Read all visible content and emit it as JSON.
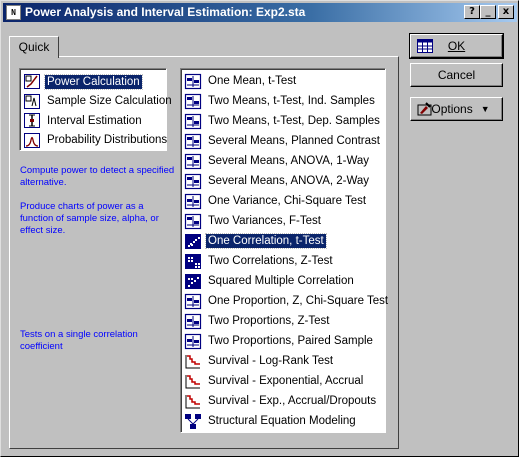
{
  "window": {
    "title": "Power Analysis and Interval Estimation: Exp2.sta",
    "controls": {
      "help": "?",
      "minimize": "_",
      "close": "x"
    }
  },
  "tabs": [
    {
      "label": "Quick"
    }
  ],
  "categories": [
    {
      "label": "Power Calculation",
      "icon": "power-calc-icon",
      "selected": true
    },
    {
      "label": "Sample Size Calculation",
      "icon": "sample-size-icon",
      "selected": false
    },
    {
      "label": "Interval Estimation",
      "icon": "interval-icon",
      "selected": false
    },
    {
      "label": "Probability Distributions",
      "icon": "distribution-icon",
      "selected": false
    }
  ],
  "descriptions": {
    "category_line1": "Compute power to detect a specified alternative.",
    "category_line2": "Produce charts of power as a function of sample size, alpha, or effect size.",
    "test_description": "Tests on a single correlation coefficient"
  },
  "tests": [
    {
      "label": "One Mean, t-Test",
      "icon": "one-mean-icon",
      "selected": false
    },
    {
      "label": "Two Means, t-Test, Ind. Samples",
      "icon": "two-means-ind-icon",
      "selected": false
    },
    {
      "label": "Two Means, t-Test, Dep. Samples",
      "icon": "two-means-dep-icon",
      "selected": false
    },
    {
      "label": "Several Means, Planned Contrast",
      "icon": "planned-contrast-icon",
      "selected": false
    },
    {
      "label": "Several Means, ANOVA, 1-Way",
      "icon": "anova-1way-icon",
      "selected": false
    },
    {
      "label": "Several Means, ANOVA, 2-Way",
      "icon": "anova-2way-icon",
      "selected": false
    },
    {
      "label": "One Variance, Chi-Square Test",
      "icon": "one-variance-icon",
      "selected": false
    },
    {
      "label": "Two Variances, F-Test",
      "icon": "two-variances-icon",
      "selected": false
    },
    {
      "label": "One Correlation, t-Test",
      "icon": "one-correlation-icon",
      "selected": true
    },
    {
      "label": "Two Correlations, Z-Test",
      "icon": "two-correlations-icon",
      "selected": false
    },
    {
      "label": "Squared Multiple Correlation",
      "icon": "multiple-correlation-icon",
      "selected": false
    },
    {
      "label": "One Proportion, Z, Chi-Square Test",
      "icon": "one-proportion-icon",
      "selected": false
    },
    {
      "label": "Two Proportions, Z-Test",
      "icon": "two-proportions-icon",
      "selected": false
    },
    {
      "label": "Two Proportions, Paired Sample",
      "icon": "paired-proportions-icon",
      "selected": false
    },
    {
      "label": "Survival - Log-Rank Test",
      "icon": "survival-curve-icon",
      "selected": false
    },
    {
      "label": "Survival - Exponential, Accrual",
      "icon": "survival-curve-icon",
      "selected": false
    },
    {
      "label": "Survival - Exp., Accrual/Dropouts",
      "icon": "survival-curve-icon",
      "selected": false
    },
    {
      "label": "Structural Equation Modeling",
      "icon": "sem-icon",
      "selected": false
    }
  ],
  "buttons": {
    "ok": "OK",
    "cancel": "Cancel",
    "options": "Options"
  },
  "colors": {
    "title_bar": "#0a246a",
    "selection": "#0a246a",
    "description_text": "#0000ff",
    "icon_blue": "#000080"
  }
}
